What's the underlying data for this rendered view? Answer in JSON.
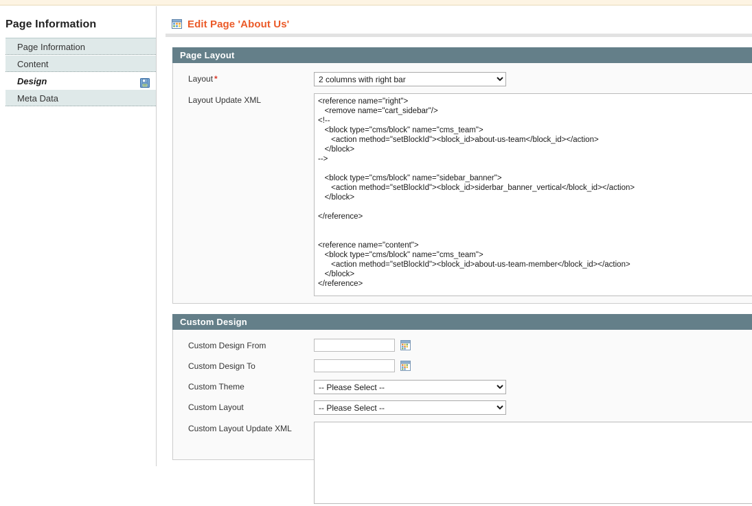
{
  "sidebar": {
    "heading": "Page Information",
    "items": [
      {
        "label": "Page Information",
        "active": false,
        "icon": ""
      },
      {
        "label": "Content",
        "active": false,
        "icon": ""
      },
      {
        "label": "Design",
        "active": true,
        "icon": "save-disk-icon"
      },
      {
        "label": "Meta Data",
        "active": false,
        "icon": ""
      }
    ]
  },
  "header": {
    "title": "Edit Page 'About Us'",
    "icon": "page-window-icon",
    "title_color": "#eb5a28"
  },
  "page_layout": {
    "section_title": "Page Layout",
    "layout_label": "Layout",
    "layout_required_mark": "*",
    "layout_value": "2 columns with right bar",
    "layout_options": [
      "2 columns with right bar"
    ],
    "layout_update_xml_label": "Layout Update XML",
    "layout_update_xml_value": "<reference name=\"right\">\n   <remove name=\"cart_sidebar\"/>\n<!--\n   <block type=\"cms/block\" name=\"cms_team\">\n      <action method=\"setBlockId\"><block_id>about-us-team</block_id></action>\n   </block>\n-->\n\n   <block type=\"cms/block\" name=\"sidebar_banner\">\n      <action method=\"setBlockId\"><block_id>siderbar_banner_vertical</block_id></action>\n   </block>\n\n</reference>\n\n\n<reference name=\"content\">\n   <block type=\"cms/block\" name=\"cms_team\">\n      <action method=\"setBlockId\"><block_id>about-us-team-member</block_id></action>\n   </block>\n</reference>"
  },
  "custom_design": {
    "section_title": "Custom Design",
    "from_label": "Custom Design From",
    "from_value": "",
    "from_placeholder": "",
    "to_label": "Custom Design To",
    "to_value": "",
    "to_placeholder": "",
    "theme_label": "Custom Theme",
    "theme_value": "-- Please Select --",
    "theme_options": [
      "-- Please Select --"
    ],
    "custom_layout_label": "Custom Layout",
    "custom_layout_value": "-- Please Select --",
    "custom_layout_options": [
      "-- Please Select --"
    ],
    "custom_layout_update_xml_label": "Custom Layout Update XML",
    "custom_layout_update_xml_value": "",
    "calendar_icon": "calendar-icon"
  },
  "colors": {
    "section_header_bg": "#647f89",
    "accent_orange": "#eb5a28",
    "sidebar_tab_bg": "#dfe9e9",
    "top_strip": "#fdf4e3"
  }
}
